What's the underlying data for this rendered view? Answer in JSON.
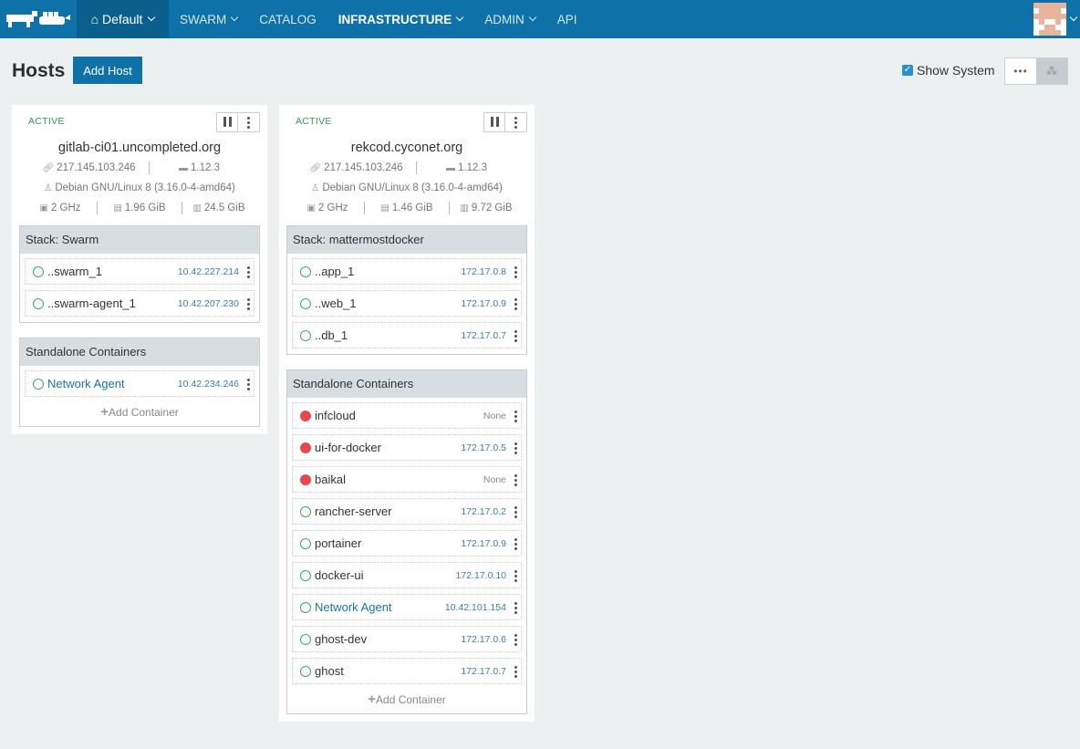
{
  "nav": {
    "environment": "Default",
    "items": [
      {
        "label": "SWARM",
        "dropdown": true,
        "active": false
      },
      {
        "label": "CATALOG",
        "dropdown": false,
        "active": false
      },
      {
        "label": "INFRASTRUCTURE",
        "dropdown": true,
        "active": true
      },
      {
        "label": "ADMIN",
        "dropdown": true,
        "active": false
      },
      {
        "label": "API",
        "dropdown": false,
        "active": false
      }
    ],
    "colors": {
      "bar": "#0e72a8",
      "env_bg": "#0b5f8c"
    }
  },
  "page": {
    "title": "Hosts",
    "add_host_label": "Add Host",
    "show_system_label": "Show System",
    "show_system_checked": true
  },
  "hosts": [
    {
      "state": "ACTIVE",
      "name": "gitlab-ci01.uncompleted.org",
      "ip": "217.145.103.246",
      "docker_version": "1.12.3",
      "os": "Debian GNU/Linux 8 (3.16.0-4-amd64)",
      "cpu": "2 GHz",
      "memory": "1.96 GiB",
      "storage": "24.5 GiB",
      "stack": {
        "label": "Stack: Swarm",
        "containers": [
          {
            "name": "..swarm_1",
            "ip": "10.42.227.214",
            "state": "running",
            "link": false
          },
          {
            "name": "..swarm-agent_1",
            "ip": "10.42.207.230",
            "state": "running",
            "link": false
          }
        ]
      },
      "standalone": {
        "label": "Standalone Containers",
        "containers": [
          {
            "name": "Network Agent",
            "ip": "10.42.234.246",
            "state": "running",
            "link": true
          }
        ],
        "add_label": "Add Container"
      }
    },
    {
      "state": "ACTIVE",
      "name": "rekcod.cyconet.org",
      "ip": "217.145.103.246",
      "docker_version": "1.12.3",
      "os": "Debian GNU/Linux 8 (3.16.0-4-amd64)",
      "cpu": "2 GHz",
      "memory": "1.46 GiB",
      "storage": "9.72 GiB",
      "stack": {
        "label": "Stack: mattermostdocker",
        "containers": [
          {
            "name": "..app_1",
            "ip": "172.17.0.8",
            "state": "running",
            "link": false
          },
          {
            "name": "..web_1",
            "ip": "172.17.0.9",
            "state": "running",
            "link": false
          },
          {
            "name": "..db_1",
            "ip": "172.17.0.7",
            "state": "running",
            "link": false
          }
        ]
      },
      "standalone": {
        "label": "Standalone Containers",
        "containers": [
          {
            "name": "infcloud",
            "ip": "None",
            "state": "stopped",
            "link": false
          },
          {
            "name": "ui-for-docker",
            "ip": "172.17.0.5",
            "state": "stopped",
            "link": false
          },
          {
            "name": "baikal",
            "ip": "None",
            "state": "stopped",
            "link": false
          },
          {
            "name": "rancher-server",
            "ip": "172.17.0.2",
            "state": "running",
            "link": false
          },
          {
            "name": "portainer",
            "ip": "172.17.0.9",
            "state": "running",
            "link": false
          },
          {
            "name": "docker-ui",
            "ip": "172.17.0.10",
            "state": "running",
            "link": false
          },
          {
            "name": "Network Agent",
            "ip": "10.42.101.154",
            "state": "running",
            "link": true
          },
          {
            "name": "ghost-dev",
            "ip": "172.17.0.6",
            "state": "running",
            "link": false
          },
          {
            "name": "ghost",
            "ip": "172.17.0.7",
            "state": "running",
            "link": false
          }
        ],
        "add_label": "Add Container"
      }
    }
  ]
}
